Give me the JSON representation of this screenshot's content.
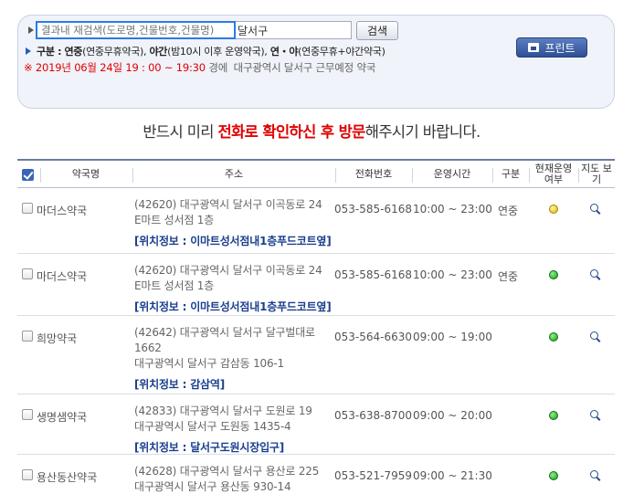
{
  "search": {
    "placeholder": "결과내 재검색(도로명,건물번호,건물명)",
    "address_value": "달서구",
    "button_label": "검색"
  },
  "legend": {
    "label": "구분 :",
    "item1_bold": "연중",
    "item1_rest": "(연중무휴약국),",
    "item2_bold": "야간",
    "item2_rest": "(밤10시 이후 운영약국),",
    "item3_bold": "연・야",
    "item3_rest": "(연중무휴+야간약국)"
  },
  "time_notice": {
    "prefix": "※ 2019년 06월 24일 19 : 00 ~ 19:30",
    "middle": "경에",
    "suffix": "대구광역시  달서구 근무예정 약국"
  },
  "print_button": "프린트",
  "notice": {
    "part1": "반드시 미리 ",
    "part2": "전화로 확인하신 후 방문",
    "part3": "해주시기 바랍니다."
  },
  "columns": {
    "name": "약국명",
    "address": "주소",
    "phone": "전화번호",
    "hours": "운영시간",
    "type": "구분",
    "status": "현재운영 여부",
    "map": "지도 보기"
  },
  "pharmacies": [
    {
      "name": "마더스약국",
      "addr1": "(42620) 대구광역시 달서구 이곡동로 24",
      "addr2": "E마트 성서점 1층",
      "location": "[위치정보 : 이마트성서점내1층푸드코트옆]",
      "phone": "053-585-6168",
      "hours": "10:00 ~ 23:00",
      "type": "연중",
      "status": "yellow"
    },
    {
      "name": "마더스약국",
      "addr1": "(42620) 대구광역시 달서구 이곡동로 24",
      "addr2": "E마트 성서점 1층",
      "location": "[위치정보 : 이마트성서점내1층푸드코트옆]",
      "phone": "053-585-6168",
      "hours": "10:00 ~ 23:00",
      "type": "연중",
      "status": "green"
    },
    {
      "name": "희망약국",
      "addr1": "(42642) 대구광역시 달서구 달구벌대로 1662",
      "addr2": "대구광역시 달서구 감삼동 106-1",
      "location": "[위치정보 : 감삼역]",
      "phone": "053-564-6630",
      "hours": "09:00 ~ 19:00",
      "type": "",
      "status": "green"
    },
    {
      "name": "생명샘약국",
      "addr1": "(42833) 대구광역시 달서구 도원로 19",
      "addr2": "대구광역시 달서구 도원동 1435-4",
      "location": "[위치정보 : 달서구도원시장입구]",
      "phone": "053-638-8700",
      "hours": "09:00 ~ 20:00",
      "type": "",
      "status": "green"
    },
    {
      "name": "용산동산약국",
      "addr1": "(42628) 대구광역시 달서구 용산로 225",
      "addr2": "대구광역시 달서구 용산동 930-14",
      "location": "",
      "phone": "053-521-7959",
      "hours": "09:00 ~ 21:30",
      "type": "",
      "status": "green"
    }
  ]
}
